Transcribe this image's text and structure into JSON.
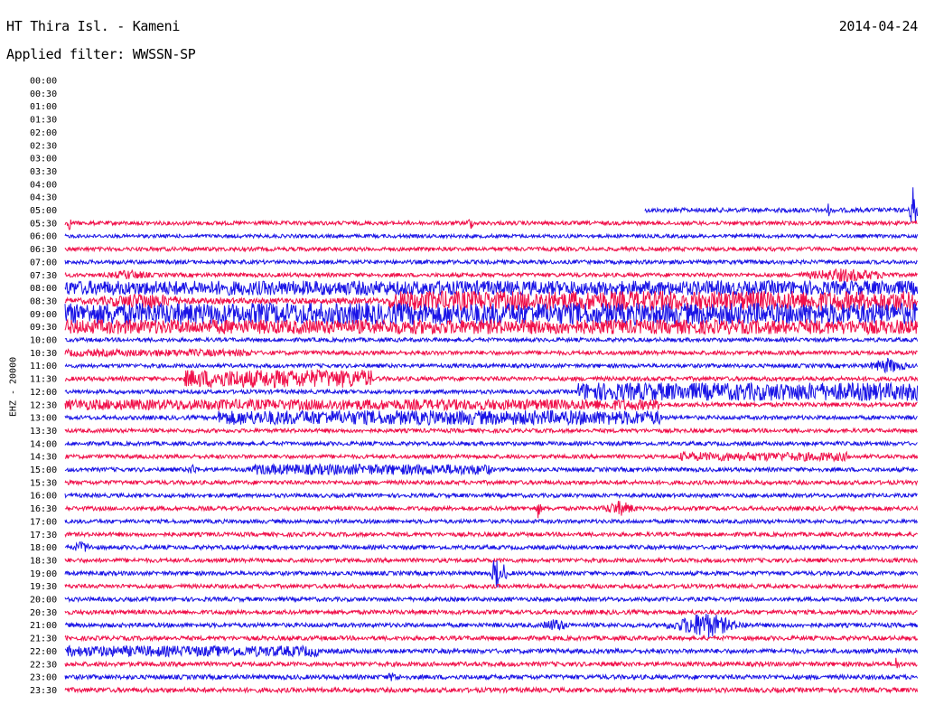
{
  "header": {
    "station": "HT Thira Isl. - Kameni",
    "date": "2014-04-24",
    "filter": "Applied filter: WWSSN-SP"
  },
  "colors": {
    "trace_a": "#1a14e6",
    "trace_b": "#f0104a",
    "background": "#ffffff"
  },
  "chart_data": {
    "type": "line",
    "subtype": "helicorder",
    "title": "HT Thira Isl. - Kameni",
    "ylabel": "EHZ - 20000",
    "xlabel": "",
    "grid": false,
    "row_labels": [
      "00:00",
      "00:30",
      "01:00",
      "01:30",
      "02:00",
      "02:30",
      "03:00",
      "03:30",
      "04:00",
      "04:30",
      "05:00",
      "05:30",
      "06:00",
      "06:30",
      "07:00",
      "07:30",
      "08:00",
      "08:30",
      "09:00",
      "09:30",
      "10:00",
      "10:30",
      "11:00",
      "11:30",
      "12:00",
      "12:30",
      "13:00",
      "13:30",
      "14:00",
      "14:30",
      "15:00",
      "15:30",
      "16:00",
      "16:30",
      "17:00",
      "17:30",
      "18:00",
      "18:30",
      "19:00",
      "19:30",
      "20:00",
      "20:30",
      "21:00",
      "21:30",
      "22:00",
      "22:30",
      "23:00",
      "23:30"
    ],
    "first_trace_row": "05:00",
    "trace_start_fraction": 0.68,
    "row_base_amplitude": [
      0,
      0,
      0,
      0,
      0,
      0,
      0,
      0,
      0,
      0,
      2.5,
      2.2,
      2,
      2.2,
      2.2,
      2.2,
      2.8,
      3.2,
      2.6,
      2.6,
      2.2,
      2.3,
      2.2,
      2.4,
      2.2,
      2.4,
      2.3,
      2.2,
      2.2,
      2.2,
      2.3,
      2.3,
      2.2,
      2.3,
      2.2,
      2.3,
      2.3,
      2.3,
      2.3,
      2.3,
      2.3,
      2.4,
      2.4,
      2.4,
      2.5,
      2.5,
      2.5,
      2.6
    ],
    "bursts": [
      {
        "row": "05:00",
        "start": 0.99,
        "end": 1.0,
        "amp": 40
      },
      {
        "row": "05:00",
        "start": 0.89,
        "end": 0.9,
        "amp": 8
      },
      {
        "row": "05:30",
        "start": 0.47,
        "end": 0.48,
        "amp": 9
      },
      {
        "row": "05:30",
        "start": 0.0,
        "end": 0.01,
        "amp": 8
      },
      {
        "row": "07:30",
        "start": 0.03,
        "end": 0.12,
        "amp": 6
      },
      {
        "row": "07:30",
        "start": 0.83,
        "end": 1.0,
        "amp": 8
      },
      {
        "row": "08:00",
        "start": 0.0,
        "end": 1.0,
        "amp": 8
      },
      {
        "row": "08:30",
        "start": 0.0,
        "end": 0.18,
        "amp": 10
      },
      {
        "row": "08:30",
        "start": 0.38,
        "end": 1.0,
        "amp": 11
      },
      {
        "row": "09:00",
        "start": 0.0,
        "end": 1.0,
        "amp": 12
      },
      {
        "row": "09:30",
        "start": 0.0,
        "end": 1.0,
        "amp": 8
      },
      {
        "row": "10:30",
        "start": 0.0,
        "end": 0.22,
        "amp": 4
      },
      {
        "row": "11:00",
        "start": 0.93,
        "end": 1.0,
        "amp": 9
      },
      {
        "row": "11:30",
        "start": 0.14,
        "end": 0.36,
        "amp": 10
      },
      {
        "row": "12:00",
        "start": 0.6,
        "end": 1.0,
        "amp": 10
      },
      {
        "row": "12:30",
        "start": 0.0,
        "end": 0.7,
        "amp": 6
      },
      {
        "row": "13:00",
        "start": 0.18,
        "end": 0.7,
        "amp": 8
      },
      {
        "row": "14:30",
        "start": 0.72,
        "end": 0.92,
        "amp": 5
      },
      {
        "row": "15:00",
        "start": 0.14,
        "end": 0.16,
        "amp": 7
      },
      {
        "row": "15:00",
        "start": 0.22,
        "end": 0.5,
        "amp": 6
      },
      {
        "row": "16:30",
        "start": 0.62,
        "end": 0.68,
        "amp": 9
      },
      {
        "row": "16:30",
        "start": 0.55,
        "end": 0.56,
        "amp": 12
      },
      {
        "row": "18:00",
        "start": 0.0,
        "end": 0.04,
        "amp": 7
      },
      {
        "row": "19:00",
        "start": 0.5,
        "end": 0.51,
        "amp": 30
      },
      {
        "row": "19:00",
        "start": 0.51,
        "end": 0.52,
        "amp": 12
      },
      {
        "row": "21:00",
        "start": 0.55,
        "end": 0.6,
        "amp": 8
      },
      {
        "row": "21:00",
        "start": 0.7,
        "end": 0.8,
        "amp": 16
      },
      {
        "row": "22:00",
        "start": 0.0,
        "end": 0.3,
        "amp": 6
      },
      {
        "row": "22:30",
        "start": 0.97,
        "end": 0.98,
        "amp": 10
      },
      {
        "row": "23:00",
        "start": 0.37,
        "end": 0.4,
        "amp": 6
      }
    ]
  }
}
